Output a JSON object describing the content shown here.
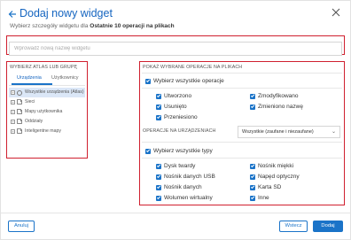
{
  "header": {
    "title": "Dodaj nowy widget",
    "subtitle_prefix": "Wybierz szczegóły widgetu dla",
    "subtitle_bold": "Ostatnie 10 operacji na plikach"
  },
  "name_field": {
    "placeholder": "Wprowadź nową nazwę widgetu",
    "value": ""
  },
  "left_panel": {
    "label": "WYBIERZ ATLAS LUB GRUPĘ",
    "tabs": [
      {
        "label": "Urządzenia",
        "active": true
      },
      {
        "label": "Użytkownicy",
        "active": false
      }
    ],
    "tree": [
      {
        "label": "Wszystkie urządzenia (Atlas)",
        "icon": "globe-icon",
        "selected": true
      },
      {
        "label": "Sieci",
        "icon": "folder-icon",
        "selected": false
      },
      {
        "label": "Mapy użytkownika",
        "icon": "folder-icon",
        "selected": false
      },
      {
        "label": "Oddziały",
        "icon": "folder-icon",
        "selected": false
      },
      {
        "label": "Inteligentne mapy",
        "icon": "folder-icon",
        "selected": false
      }
    ]
  },
  "right_panel": {
    "ops_label": "POKAŻ WYBRANE OPERACJE NA PLIKACH",
    "select_all_ops": "Wybierz wszystkie operacje",
    "operations": [
      "Utworzono",
      "Zmodyfikowano",
      "Usunięto",
      "Zmieniono nazwę",
      "Przeniesiono"
    ],
    "devices_label": "OPERACJE NA URZĄDZENIACH",
    "dropdown_value": "Wszystkie (zaufane i niezaufane)",
    "select_all_types": "Wybierz wszystkie typy",
    "device_types": [
      "Dysk twardy",
      "Nośnik miękki",
      "Nośnik danych USB",
      "Napęd optyczny",
      "Nośnik danych",
      "Karta SD",
      "Wolumen wirtualny",
      "Inne"
    ]
  },
  "footer": {
    "cancel_label": "Anuluj",
    "clear_label": "Wstecz",
    "add_label": "Dodaj"
  },
  "colors": {
    "accent": "#1a73c8",
    "highlight": "#d0202f"
  }
}
